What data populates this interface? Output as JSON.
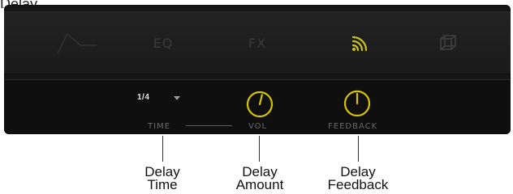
{
  "top_fragment": "Delay",
  "tabs": [
    {
      "name": "envelope",
      "icon": "envelope-icon",
      "active": false
    },
    {
      "name": "eq",
      "label": "EQ",
      "active": false
    },
    {
      "name": "fx",
      "label": "FX",
      "active": false
    },
    {
      "name": "delay",
      "icon": "delay-waves-icon",
      "active": true
    },
    {
      "name": "3d",
      "icon": "cube-icon",
      "active": false
    }
  ],
  "delay": {
    "time_value": "1/4",
    "time_label": "TIME",
    "vol_label": "VOL",
    "feedback_label": "FEEDBACK",
    "vol_level": 0.55,
    "feedback_level": 0.5
  },
  "callouts": [
    {
      "line1": "Delay",
      "line2": "Time"
    },
    {
      "line1": "Delay",
      "line2": "Amount"
    },
    {
      "line1": "Delay",
      "line2": "Feedback"
    }
  ],
  "colors": {
    "accent": "#c8c22a",
    "knob": "#d9c400",
    "inactive_tab": "#3a3a3a",
    "panel": "#151515"
  }
}
